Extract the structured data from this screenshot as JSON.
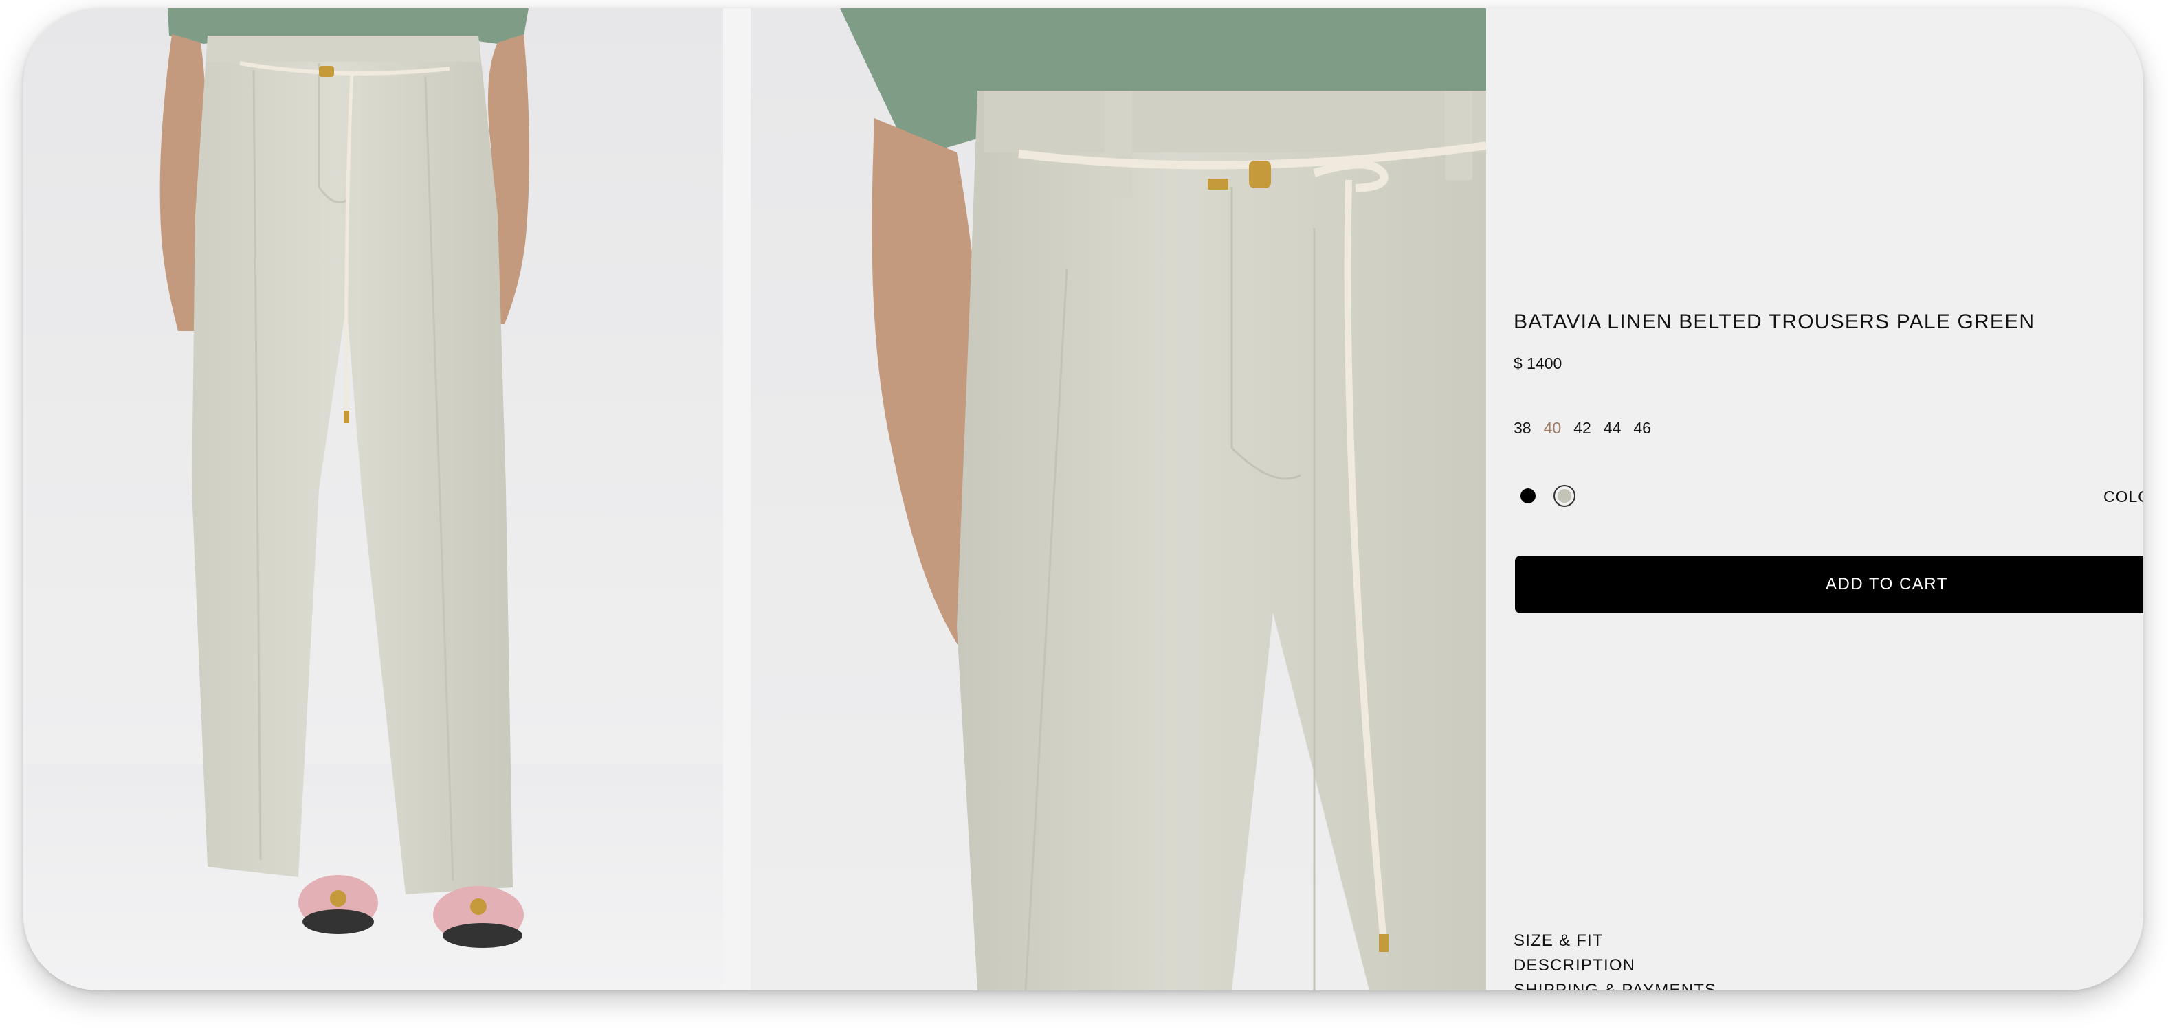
{
  "product": {
    "title": "BATAVIA LINEN BELTED TROUSERS PALE GREEN",
    "price": "$ 1400",
    "sizes": [
      "38",
      "40",
      "42",
      "44",
      "46"
    ],
    "selected_size": "40",
    "colors": [
      {
        "name": "black",
        "hex": "#000000"
      },
      {
        "name": "pale-green",
        "hex": "#c3c3b8"
      }
    ],
    "color_label": "COLO",
    "add_to_cart_label": "ADD TO CART"
  },
  "info_sections": [
    "SIZE & FIT",
    "DESCRIPTION",
    "SHIPPING & PAYMENTS"
  ],
  "theme": {
    "accent": "#9d7a62",
    "button_bg": "#000000",
    "panel_bg": "#f0f0f1",
    "trouser_color": "#d6d6cc",
    "top_color": "#7f9c86"
  },
  "gallery": {
    "images": [
      "full-length model view",
      "close-up waist detail view"
    ]
  }
}
